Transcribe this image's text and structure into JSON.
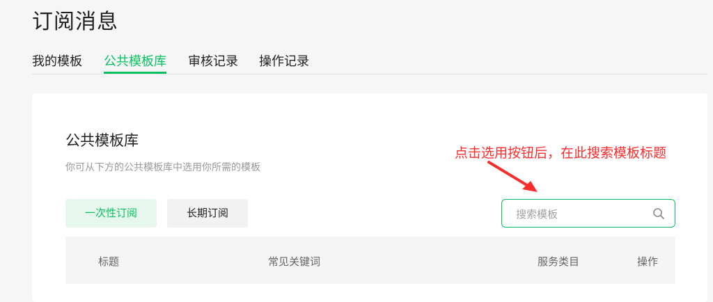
{
  "page": {
    "title": "订阅消息"
  },
  "tabs": [
    {
      "label": "我的模板",
      "active": false
    },
    {
      "label": "公共模板库",
      "active": true
    },
    {
      "label": "审核记录",
      "active": false
    },
    {
      "label": "操作记录",
      "active": false
    }
  ],
  "library": {
    "title": "公共模板库",
    "description": "你可从下方的公共模板库中选用你所需的模板",
    "type_buttons": [
      {
        "label": "一次性订阅",
        "selected": true
      },
      {
        "label": "长期订阅",
        "selected": false
      }
    ],
    "search": {
      "placeholder": "搜索模板",
      "value": ""
    },
    "table": {
      "columns": [
        "标题",
        "常见关键词",
        "服务类目",
        "操作"
      ]
    }
  },
  "annotation": {
    "text": "点击选用按钮后，在此搜索模板标题",
    "color": "#fa2d2d"
  },
  "colors": {
    "accent": "#07c160",
    "accent_bg": "#e8f7ee",
    "page_bg": "#f6f6f6"
  },
  "icons": {
    "search": "search-icon",
    "arrow": "red-arrow-icon"
  }
}
